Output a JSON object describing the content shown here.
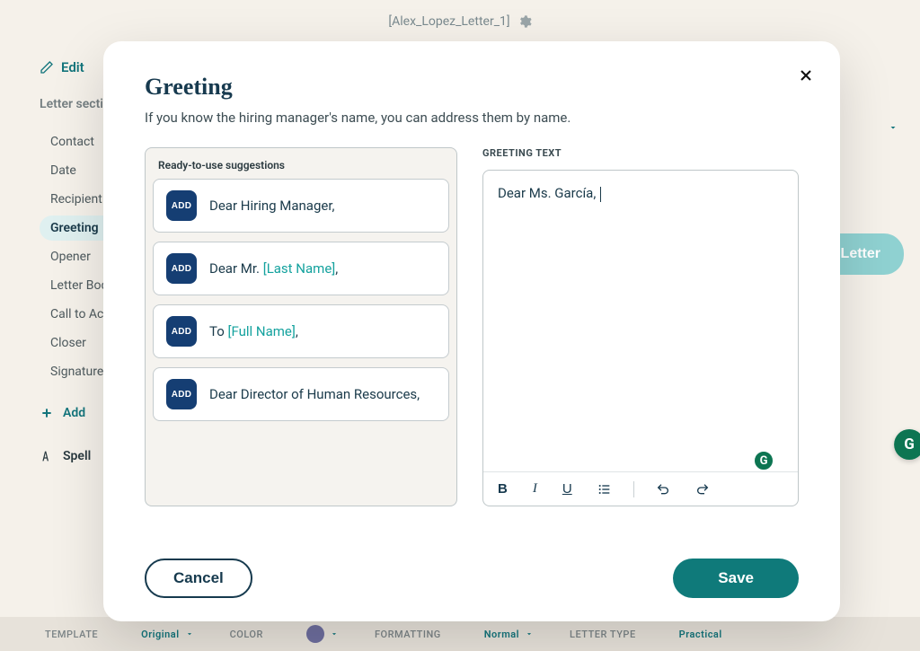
{
  "document": {
    "title": "[Alex_Lopez_Letter_1]"
  },
  "actions": {
    "edit": "Edit"
  },
  "sidebar": {
    "title": "Letter sections",
    "items": [
      {
        "label": "Contact",
        "active": false
      },
      {
        "label": "Date",
        "active": false
      },
      {
        "label": "Recipient",
        "active": false
      },
      {
        "label": "Greeting",
        "active": true
      },
      {
        "label": "Opener",
        "active": false
      },
      {
        "label": "Letter Body",
        "active": false
      },
      {
        "label": "Call to Action",
        "active": false
      },
      {
        "label": "Closer",
        "active": false
      },
      {
        "label": "Signature",
        "active": false
      }
    ],
    "add_label": "Add",
    "spell_label": "Spell"
  },
  "preview": {
    "label": "Letter"
  },
  "modal": {
    "title": "Greeting",
    "subtitle": "If you know the hiring manager's name, you can address them by name.",
    "suggestions_header": "Ready-to-use suggestions",
    "add_label": "ADD",
    "suggestions": [
      {
        "prefix": "Dear Hiring Manager,",
        "placeholder": "",
        "suffix": ""
      },
      {
        "prefix": "Dear Mr. ",
        "placeholder": "[Last Name]",
        "suffix": ","
      },
      {
        "prefix": "To ",
        "placeholder": "[Full Name]",
        "suffix": ","
      },
      {
        "prefix": "Dear Director of Human Resources,",
        "placeholder": "",
        "suffix": ""
      }
    ],
    "textarea_label": "GREETING TEXT",
    "textarea_value": "Dear Ms. García,",
    "cancel": "Cancel",
    "save": "Save"
  },
  "bottom_bar": {
    "template": {
      "label": "TEMPLATE",
      "value": "Original"
    },
    "color": {
      "label": "COLOR"
    },
    "formatting": {
      "label": "FORMATTING",
      "value": "Normal"
    },
    "letter_type": {
      "label": "LETTER TYPE",
      "value": "Practical"
    }
  },
  "grammarly": "G"
}
